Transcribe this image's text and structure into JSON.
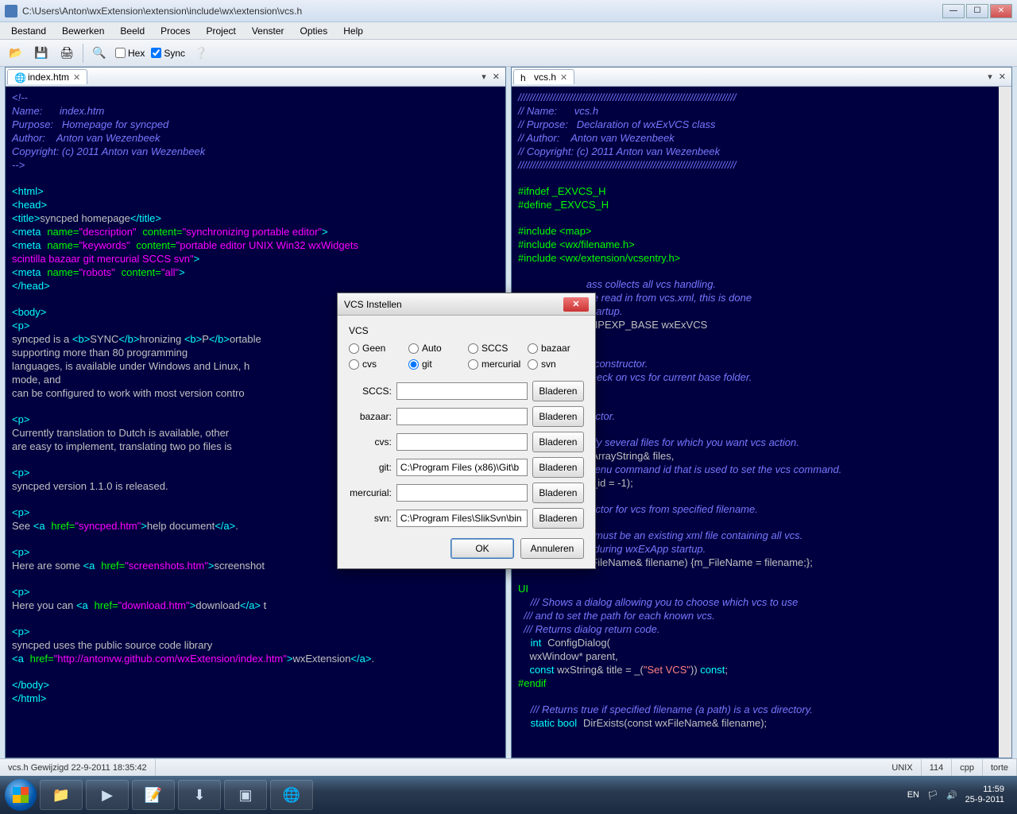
{
  "window": {
    "title": "C:\\Users\\Anton\\wxExtension\\extension\\include\\wx\\extension\\vcs.h",
    "controls": {
      "min": "—",
      "max": "☐",
      "close": "✕"
    }
  },
  "menu": [
    "Bestand",
    "Bewerken",
    "Beeld",
    "Proces",
    "Project",
    "Venster",
    "Opties",
    "Help"
  ],
  "toolbar": {
    "hex_label": "Hex",
    "sync_label": "Sync"
  },
  "tabs": {
    "left": {
      "name": "index.htm"
    },
    "right": {
      "name": "vcs.h"
    }
  },
  "dialog": {
    "title": "VCS Instellen",
    "group": "VCS",
    "radios": [
      "Geen",
      "Auto",
      "SCCS",
      "bazaar",
      "cvs",
      "git",
      "mercurial",
      "svn"
    ],
    "selected": "git",
    "paths": [
      {
        "label": "SCCS:",
        "value": ""
      },
      {
        "label": "bazaar:",
        "value": ""
      },
      {
        "label": "cvs:",
        "value": ""
      },
      {
        "label": "git:",
        "value": "C:\\Program Files (x86)\\Git\\b"
      },
      {
        "label": "mercurial:",
        "value": ""
      },
      {
        "label": "svn:",
        "value": "C:\\Program Files\\SlikSvn\\bin"
      }
    ],
    "browse": "Bladeren",
    "ok": "OK",
    "cancel": "Annuleren"
  },
  "status": {
    "left": "vcs.h Gewijzigd 22-9-2011 18:35:42",
    "format": "UNIX",
    "line": "114",
    "lang": "cpp",
    "theme": "torte"
  },
  "tray": {
    "lang": "EN",
    "time": "11:59",
    "date": "25-9-2011"
  }
}
